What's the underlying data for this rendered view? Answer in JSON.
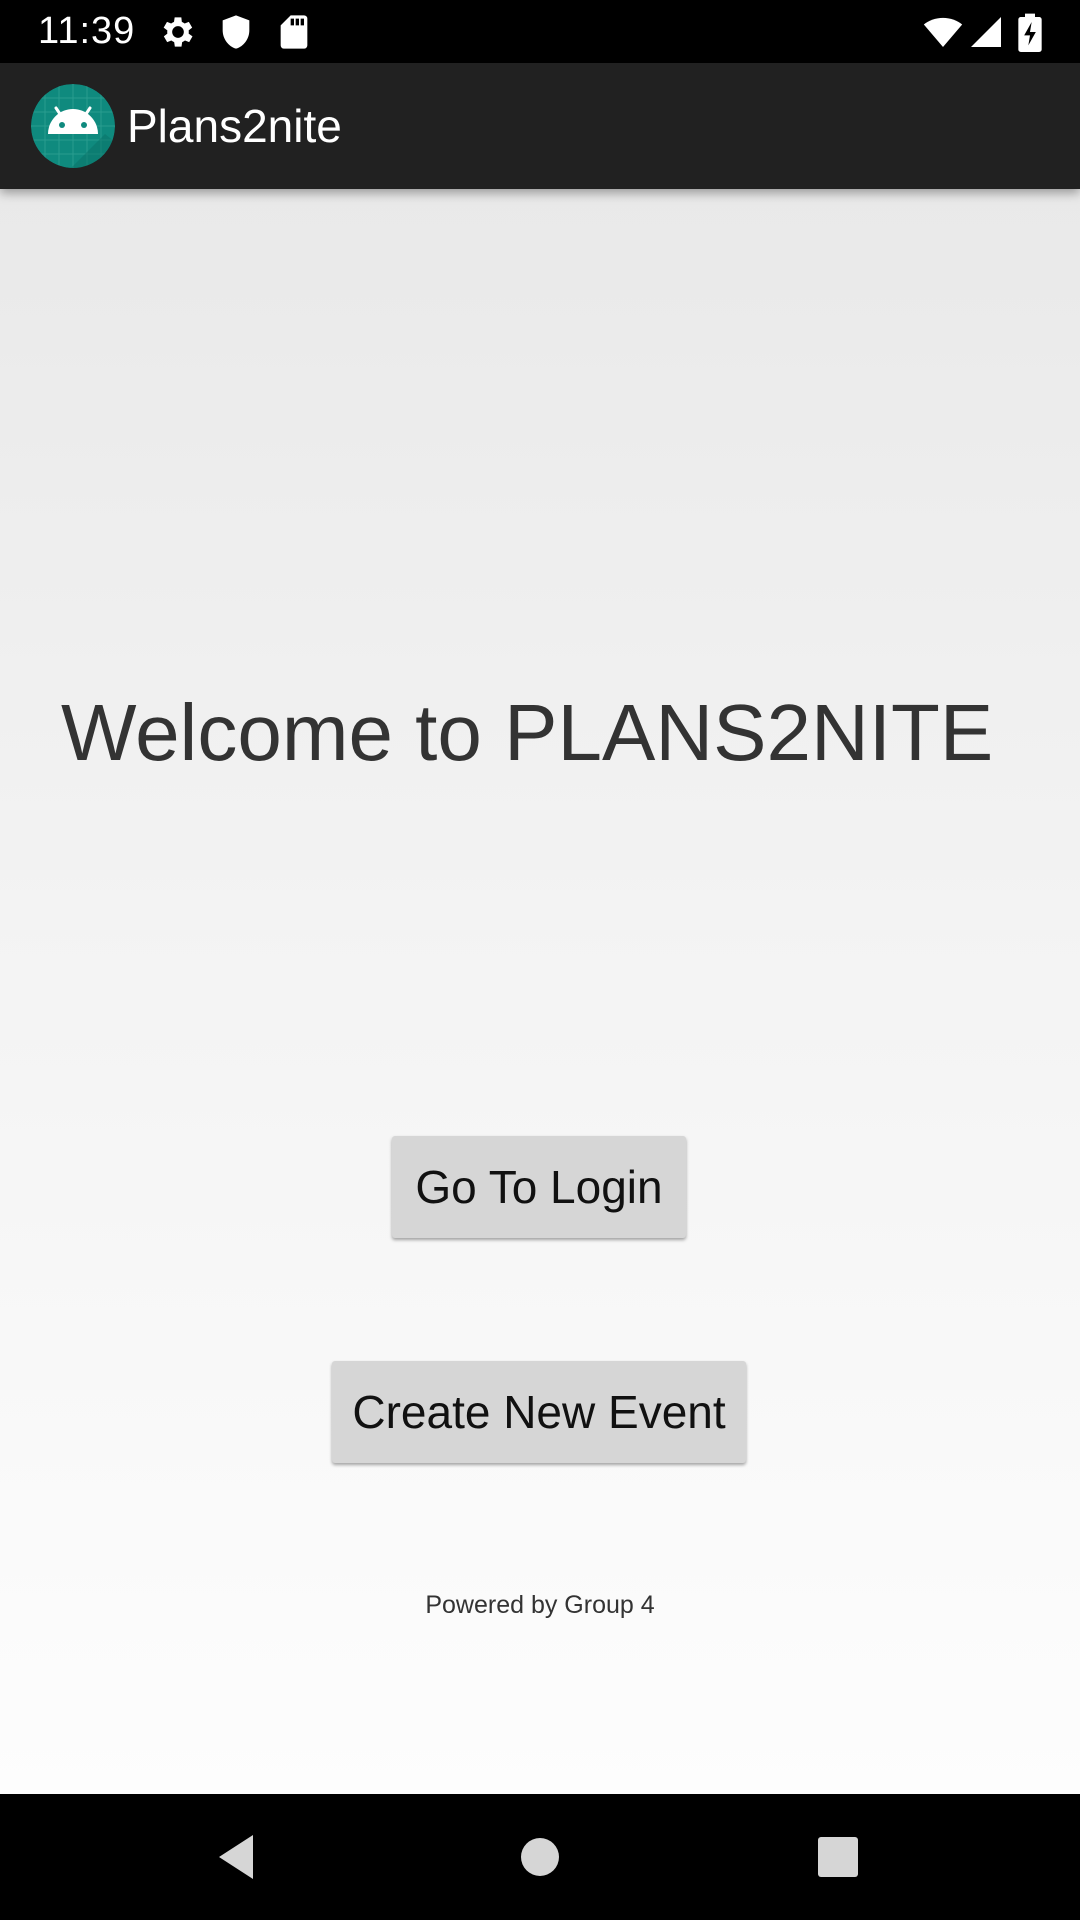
{
  "status_bar": {
    "time": "11:39",
    "left_icons": [
      "gear-icon",
      "shield-icon",
      "sd-card-icon"
    ],
    "right_icons": [
      "wifi-icon",
      "cell-signal-icon",
      "battery-charging-icon"
    ]
  },
  "app_bar": {
    "title": "Plans2nite",
    "logo_icon": "android-icon",
    "background_color": "#212121",
    "logo_color": "#0f8a7e"
  },
  "main": {
    "welcome_text": "Welcome to PLANS2NITE",
    "login_button_label": "Go To Login",
    "create_event_button_label": "Create New Event",
    "footer_text": "Powered by Group 4"
  },
  "nav_bar": {
    "icons": [
      "back-icon",
      "home-icon",
      "recents-icon"
    ]
  }
}
